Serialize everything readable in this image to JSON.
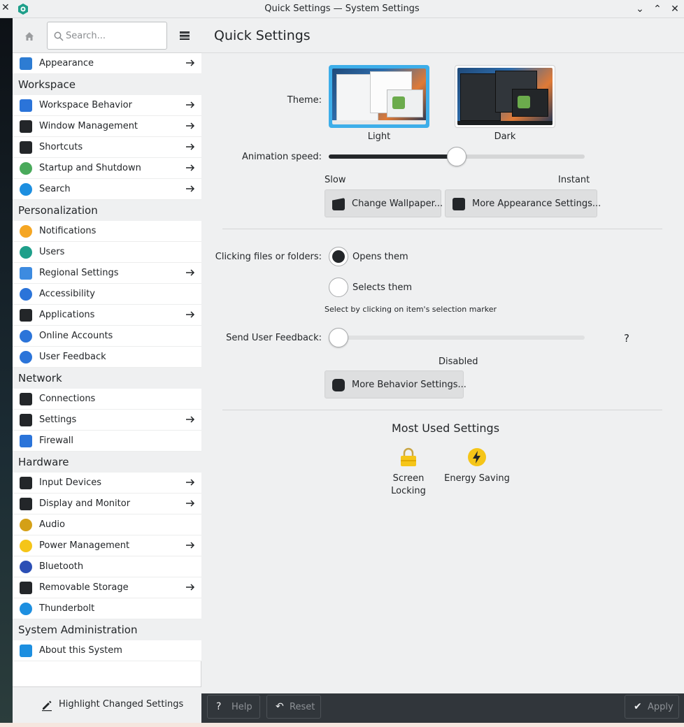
{
  "window": {
    "title": "Quick Settings — System Settings",
    "left_close": "✕",
    "buttons": {
      "minimize": "⌄",
      "maximize": "⌃",
      "close": "✕"
    }
  },
  "sidebar": {
    "search_placeholder": "Search...",
    "items": [
      {
        "type": "item",
        "label": "Appearance",
        "icon": "appearance-icon",
        "color": "#2d7cd3",
        "arrow": true
      },
      {
        "type": "category",
        "label": "Workspace"
      },
      {
        "type": "item",
        "label": "Workspace Behavior",
        "icon": "workspace-behavior-icon",
        "color": "#2b74d9",
        "arrow": true
      },
      {
        "type": "item",
        "label": "Window Management",
        "icon": "window-management-icon",
        "color": "#232629",
        "arrow": true
      },
      {
        "type": "item",
        "label": "Shortcuts",
        "icon": "shortcuts-icon",
        "color": "#232629",
        "arrow": true
      },
      {
        "type": "item",
        "label": "Startup and Shutdown",
        "icon": "rocket-icon",
        "color": "#4aaa5b",
        "arrow": true
      },
      {
        "type": "item",
        "label": "Search",
        "icon": "search-icon",
        "color": "#1d8fe0",
        "arrow": true
      },
      {
        "type": "category",
        "label": "Personalization"
      },
      {
        "type": "item",
        "label": "Notifications",
        "icon": "bell-icon",
        "color": "#f5a623",
        "arrow": false
      },
      {
        "type": "item",
        "label": "Users",
        "icon": "user-icon",
        "color": "#1e9f8a",
        "arrow": false
      },
      {
        "type": "item",
        "label": "Regional Settings",
        "icon": "language-icon",
        "color": "#3d8be0",
        "arrow": true
      },
      {
        "type": "item",
        "label": "Accessibility",
        "icon": "accessibility-icon",
        "color": "#2b74d9",
        "arrow": false
      },
      {
        "type": "item",
        "label": "Applications",
        "icon": "applications-icon",
        "color": "#232629",
        "arrow": true
      },
      {
        "type": "item",
        "label": "Online Accounts",
        "icon": "online-accounts-icon",
        "color": "#2b74d9",
        "arrow": false
      },
      {
        "type": "item",
        "label": "User Feedback",
        "icon": "user-feedback-icon",
        "color": "#2b74d9",
        "arrow": false
      },
      {
        "type": "category",
        "label": "Network"
      },
      {
        "type": "item",
        "label": "Connections",
        "icon": "connections-icon",
        "color": "#232629",
        "arrow": false
      },
      {
        "type": "item",
        "label": "Settings",
        "icon": "network-settings-icon",
        "color": "#232629",
        "arrow": true
      },
      {
        "type": "item",
        "label": "Firewall",
        "icon": "firewall-icon",
        "color": "#2b74d9",
        "arrow": false
      },
      {
        "type": "category",
        "label": "Hardware"
      },
      {
        "type": "item",
        "label": "Input Devices",
        "icon": "mouse-icon",
        "color": "#232629",
        "arrow": true
      },
      {
        "type": "item",
        "label": "Display and Monitor",
        "icon": "monitor-icon",
        "color": "#232629",
        "arrow": true
      },
      {
        "type": "item",
        "label": "Audio",
        "icon": "speaker-icon",
        "color": "#d4a017",
        "arrow": false
      },
      {
        "type": "item",
        "label": "Power Management",
        "icon": "power-icon",
        "color": "#f5c518",
        "arrow": true
      },
      {
        "type": "item",
        "label": "Bluetooth",
        "icon": "bluetooth-icon",
        "color": "#2b4fb5",
        "arrow": false
      },
      {
        "type": "item",
        "label": "Removable Storage",
        "icon": "storage-icon",
        "color": "#232629",
        "arrow": true
      },
      {
        "type": "item",
        "label": "Thunderbolt",
        "icon": "thunderbolt-icon",
        "color": "#1d8fe0",
        "arrow": false
      },
      {
        "type": "category",
        "label": "System Administration"
      },
      {
        "type": "item",
        "label": "About this System",
        "icon": "info-icon",
        "color": "#1d8fe0",
        "arrow": false
      }
    ],
    "highlight_button": "Highlight Changed Settings"
  },
  "main": {
    "title": "Quick Settings",
    "theme_label": "Theme:",
    "themes": [
      {
        "label": "Light",
        "selected": true
      },
      {
        "label": "Dark",
        "selected": false
      }
    ],
    "animation_label": "Animation speed:",
    "animation_value": 0.5,
    "slow_label": "Slow",
    "instant_label": "Instant",
    "change_wallpaper": "Change Wallpaper...",
    "more_appearance": "More Appearance Settings...",
    "clicking_label": "Clicking files or folders:",
    "opens_them": "Opens them",
    "selects_them": "Selects them",
    "select_hint": "Select by clicking on item's selection marker",
    "feedback_label": "Send User Feedback:",
    "feedback_value": 0,
    "feedback_help": "?",
    "feedback_state": "Disabled",
    "more_behavior": "More Behavior Settings...",
    "most_used_title": "Most Used Settings",
    "most_used": [
      {
        "label": "Screen\nLocking",
        "icon": "lock-icon",
        "color": "#f5c518"
      },
      {
        "label": "Energy Saving",
        "icon": "power-icon",
        "color": "#f5c518"
      }
    ]
  },
  "bottom": {
    "help": "Help",
    "reset": "Reset",
    "apply": "Apply"
  },
  "colors": {
    "accent": "#3daee9",
    "sidebar_bg": "#ffffff",
    "main_bg": "#eff0f1",
    "bottom_bar": "#31363b"
  }
}
